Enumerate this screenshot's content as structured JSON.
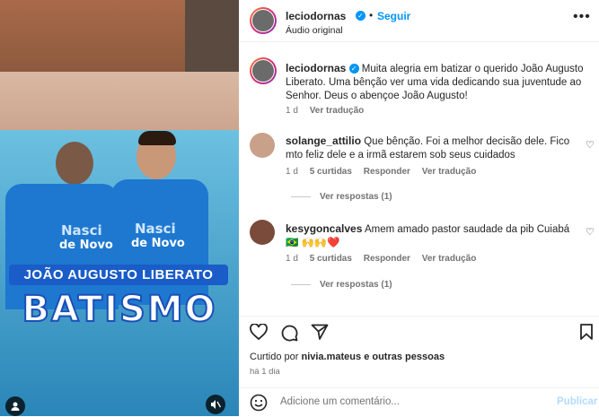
{
  "media": {
    "overlay_name": "JOÃO AUGUSTO LIBERATO",
    "overlay_title": "BATISMO",
    "shirt_text_1": "Nasci",
    "shirt_text_2": "de Novo",
    "user_icon": "user-icon",
    "mute_icon": "mute-icon"
  },
  "header": {
    "username": "leciodornas",
    "follow_label": "Seguir",
    "audio_label": "Áudio original",
    "more_icon": "more-icon"
  },
  "caption": {
    "username": "leciodornas",
    "text": "Muita alegria em batizar o querido João Augusto Liberato. Uma bênção ver uma vida dedicando sua juventude ao Senhor. Deus o abençoe João Augusto!",
    "time": "1 d",
    "translate": "Ver tradução"
  },
  "comments": [
    {
      "username": "solange_attilio",
      "text": "Que bênção. Foi a melhor decisão dele. Fico mto feliz dele e a irmã estarem sob seus cuidados",
      "time": "1 d",
      "likes": "5 curtidas",
      "reply": "Responder",
      "translate": "Ver tradução",
      "view_replies": "Ver respostas (1)"
    },
    {
      "username": "kesygoncalves",
      "text": "Amem amado pastor saudade da pib Cuiabá 🇧🇷 🙌🙌❤️",
      "time": "1 d",
      "likes": "5 curtidas",
      "reply": "Responder",
      "translate": "Ver tradução",
      "view_replies": "Ver respostas (1)"
    }
  ],
  "likes_line": {
    "prefix": "Curtido por",
    "user": "nivia.mateus",
    "suffix": "e outras pessoas"
  },
  "post_time": "há 1 dia",
  "comment_box": {
    "placeholder": "Adicione um comentário...",
    "publish": "Publicar"
  },
  "colors": {
    "accent": "#0095f6",
    "text": "#262626",
    "muted": "#737373"
  }
}
